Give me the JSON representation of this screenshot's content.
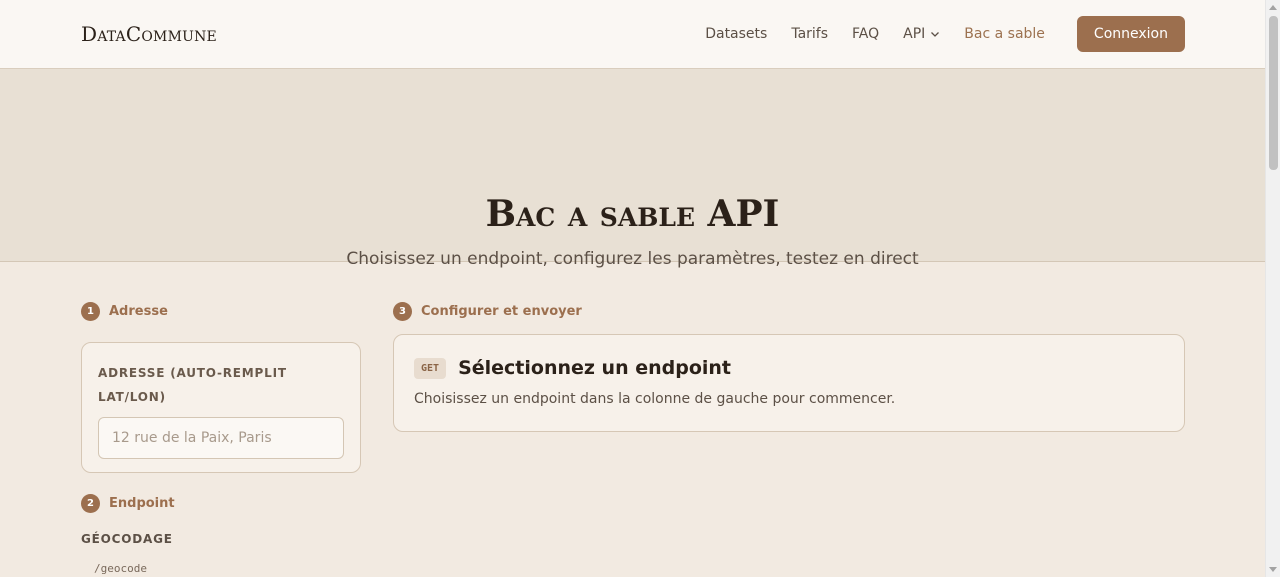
{
  "header": {
    "brand": "DataCommune",
    "nav": [
      {
        "label": "Datasets"
      },
      {
        "label": "Tarifs"
      },
      {
        "label": "FAQ"
      },
      {
        "label": "API"
      },
      {
        "label": "Bac a sable"
      }
    ],
    "api_icon": "chevron-down-icon",
    "active_nav": "Bac a sable",
    "login_label": "Connexion"
  },
  "hero": {
    "title": "Bac a sable API",
    "subtitle": "Choisissez un endpoint, configurez les paramètres, testez en direct"
  },
  "steps": {
    "address": {
      "number": "1",
      "label": "Adresse"
    },
    "endpoint": {
      "number": "2",
      "label": "Endpoint"
    },
    "configure": {
      "number": "3",
      "label": "Configurer et envoyer"
    }
  },
  "address_card": {
    "field_label": "Adresse (auto-remplit lat/lon)",
    "input_value": "",
    "input_placeholder": "12 rue de la Paix, Paris"
  },
  "endpoints": {
    "group_title": "Géocodage",
    "items": [
      "/geocode"
    ]
  },
  "endpoint_card": {
    "method": "GET",
    "title": "Sélectionnez un endpoint",
    "description": "Choisissez un endpoint dans la colonne de gauche pour commencer."
  },
  "colors": {
    "accent": "#9c6f4e",
    "background": "#f2eae1",
    "hero_background": "#e8e0d4",
    "header_background": "#faf7f3"
  }
}
